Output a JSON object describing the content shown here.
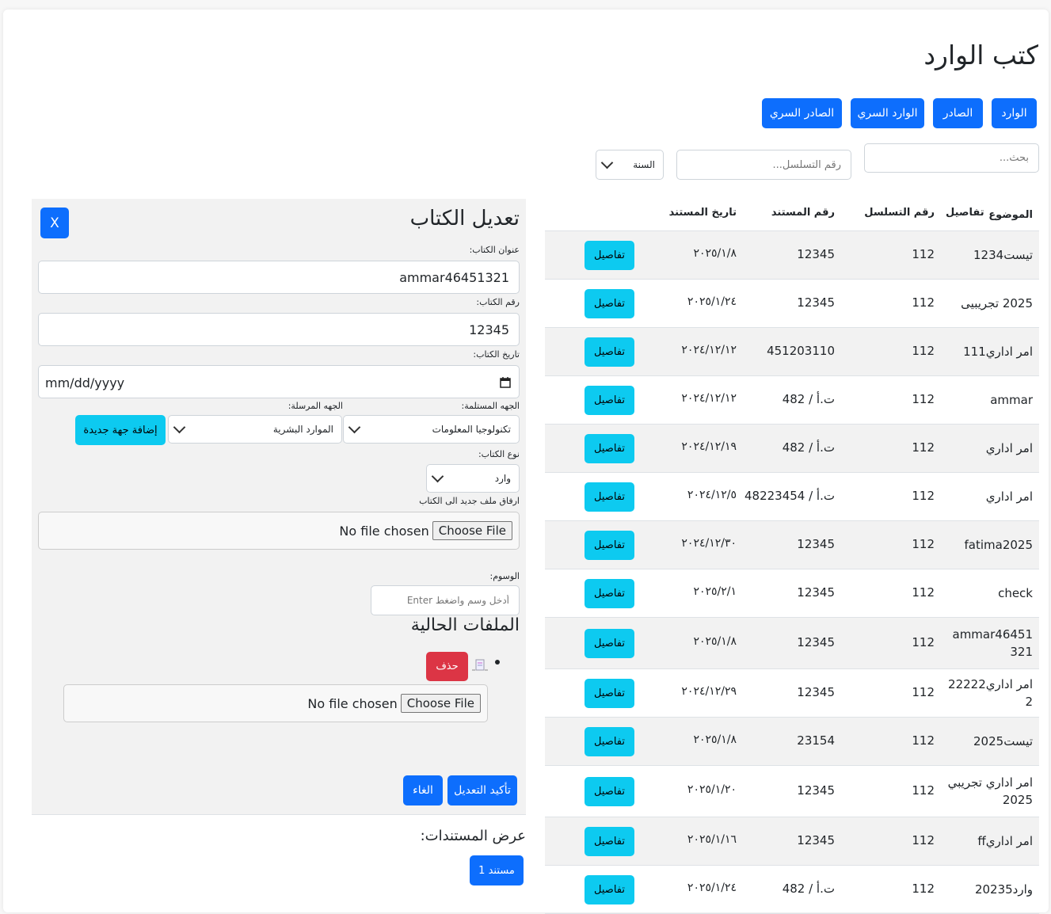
{
  "page": {
    "title": "كتب الوارد"
  },
  "nav": [
    "الوارد",
    "الصادر",
    "الوارد السري",
    "الصادر السري"
  ],
  "filters": {
    "search_placeholder": "بحث...",
    "serial_placeholder": "رقم التسلسل...",
    "year_label": "السنة"
  },
  "table": {
    "headers": {
      "subject": "الموضوع",
      "serial": "رقم التسلسل",
      "doc_number": "رقم المستند",
      "doc_date": "تاريخ المستند",
      "details": "تفاصيل"
    },
    "details_label": "تفاصيل",
    "rows": [
      {
        "subject": "تيست1234",
        "serial": "112",
        "doc_number": "12345",
        "date": "٢٠٢٥/١/٨"
      },
      {
        "subject": "2025 تجريبيى",
        "serial": "112",
        "doc_number": "12345",
        "date": "٢٠٢٥/١/٢٤"
      },
      {
        "subject": "امر اداري111",
        "serial": "112",
        "doc_number": "451203110",
        "date": "٢٠٢٤/١٢/١٢"
      },
      {
        "subject": "ammar",
        "serial": "112",
        "doc_number": "ت.أ / 482",
        "date": "٢٠٢٤/١٢/١٢"
      },
      {
        "subject": "امر اداري",
        "serial": "112",
        "doc_number": "ت.أ / 482",
        "date": "٢٠٢٤/١٢/١٩"
      },
      {
        "subject": "امر اداري",
        "serial": "112",
        "doc_number": "ت.أ / 48223454",
        "date": "٢٠٢٤/١٢/٥"
      },
      {
        "subject": "fatima2025",
        "serial": "112",
        "doc_number": "12345",
        "date": "٢٠٢٤/١٢/٣٠"
      },
      {
        "subject": "check",
        "serial": "112",
        "doc_number": "12345",
        "date": "٢٠٢٥/٢/١"
      },
      {
        "subject": "ammar46451321",
        "serial": "112",
        "doc_number": "12345",
        "date": "٢٠٢٥/١/٨"
      },
      {
        "subject": "امر اداري222222",
        "serial": "112",
        "doc_number": "12345",
        "date": "٢٠٢٤/١٢/٢٩"
      },
      {
        "subject": "تيست2025",
        "serial": "112",
        "doc_number": "23154",
        "date": "٢٠٢٥/١/٨"
      },
      {
        "subject": "امر اداري تجريبي 2025",
        "serial": "112",
        "doc_number": "12345",
        "date": "٢٠٢٥/١/٢٠"
      },
      {
        "subject": "امر اداريff",
        "serial": "112",
        "doc_number": "12345",
        "date": "٢٠٢٥/١/١٦"
      },
      {
        "subject": "وارد20235",
        "serial": "112",
        "doc_number": "ت.أ / 482",
        "date": "٢٠٢٥/١/٢٤"
      }
    ]
  },
  "edit": {
    "title": "تعديل الكتاب",
    "close_label": "X",
    "title_label": "عنوان الكتاب:",
    "title_value": "ammar46451321",
    "number_label": "رقم الكتاب:",
    "number_value": "12345",
    "date_label": "تاريخ الكتاب:",
    "date_placeholder": "mm/dd/yyyy",
    "receiver_label": "الجهه المستلمة:",
    "receiver_value": "تكنولوجيا المعلومات",
    "sender_label": "الجهه المرسلة:",
    "sender_value": "الموارد البشرية",
    "add_entity_label": "إضافة جهة جديدة",
    "type_label": "نوع الكتاب:",
    "type_value": "وارد",
    "attach_label": "ارفاق ملف جديد الى الكتاب",
    "choose_file": "Choose File",
    "no_file": "No file chosen",
    "tags_label": "الوسوم:",
    "tags_placeholder": "أدخل وسم واضغط Enter",
    "current_files_title": "الملفات الحالية",
    "delete_label": "حذف",
    "confirm_label": "تأكيد التعديل",
    "cancel_label": "الغاء"
  },
  "documents": {
    "title": "عرض المستندات:",
    "doc_button": "مستند 1"
  }
}
